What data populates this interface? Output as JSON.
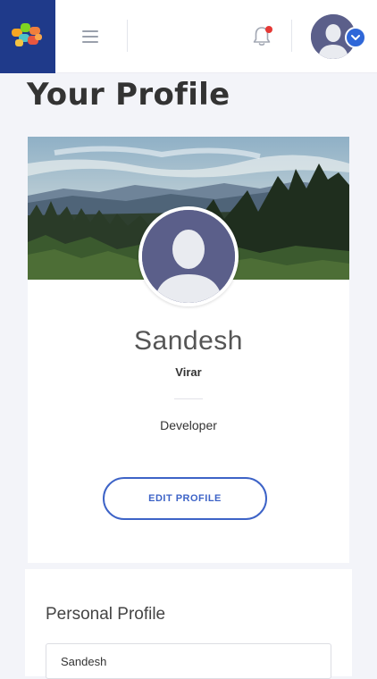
{
  "header": {
    "logo_icon": "puzzle-logo-icon",
    "menu_icon": "hamburger-menu-icon",
    "notification_icon": "bell-icon",
    "notification_dot_color": "#e53935",
    "avatar_icon": "user-avatar-icon",
    "dropdown_icon": "chevron-down-icon",
    "brand_color": "#1f3a8a",
    "accent_color": "#2f67d8"
  },
  "page": {
    "title": "Your Profile"
  },
  "profile": {
    "name": "Sandesh",
    "location": "Virar",
    "role": "Developer",
    "edit_button_label": "EDIT PROFILE",
    "cover_image": "mountain-forest-landscape",
    "avatar_icon": "user-avatar-icon"
  },
  "personal_profile": {
    "title": "Personal Profile",
    "name_value": "Sandesh"
  }
}
